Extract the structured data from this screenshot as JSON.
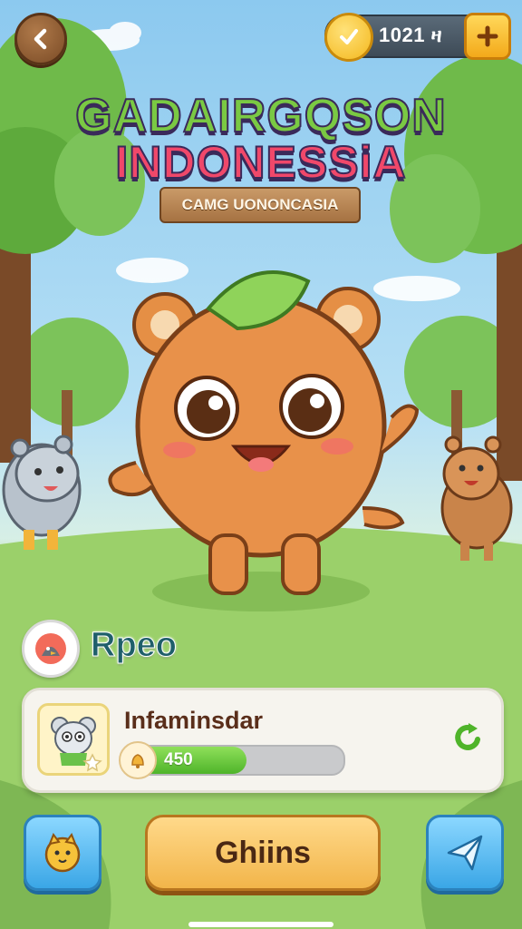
{
  "header": {
    "coin_count": "1021 ዛ",
    "title_line1": "GADAIRGQSON",
    "title_line2": "INDONESSiA",
    "subtitle": "CAMG UONONCASIA"
  },
  "player": {
    "name": "Rpeo"
  },
  "card": {
    "title": "Infaminsdar",
    "progress_label": "450",
    "progress_fraction": 0.55
  },
  "actions": {
    "main_label": "Ghiins"
  },
  "colors": {
    "accent_green": "#4fb42a",
    "button_gold": "#f2b54a",
    "button_blue": "#3aa6e6",
    "title_pink": "#f0486a",
    "title_green": "#7ac943"
  },
  "icons": {
    "back": "chevron-left-icon",
    "coin": "check-coin-icon",
    "add": "plus-icon",
    "refresh": "refresh-icon",
    "bell": "bell-icon",
    "pet": "pet-icon",
    "send": "send-icon"
  }
}
